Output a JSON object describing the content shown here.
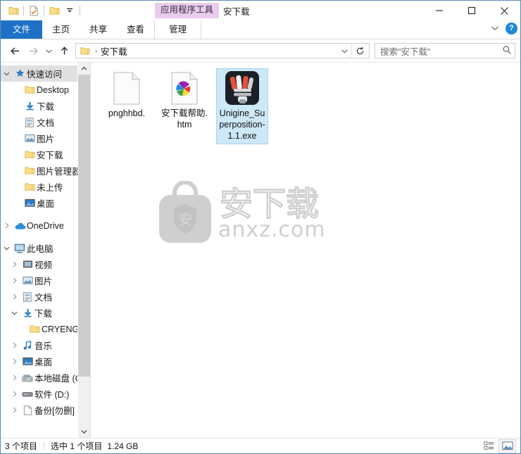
{
  "window": {
    "title": "安下载",
    "contextual_tab_label": "应用程序工具",
    "controls": {
      "minimize": "—",
      "maximize": "▢",
      "close": "✕"
    }
  },
  "quick_access_toolbar": {
    "items": [
      {
        "name": "folder-icon",
        "label": "属性"
      },
      {
        "name": "properties-icon",
        "label": "属性"
      },
      {
        "name": "new-folder-icon",
        "label": "新建文件夹"
      },
      {
        "name": "customize-dropdown-icon",
        "label": "自定义快速访问工具栏"
      }
    ]
  },
  "ribbon": {
    "tabs": [
      {
        "label": "文件",
        "state": "file"
      },
      {
        "label": "主页",
        "state": "normal"
      },
      {
        "label": "共享",
        "state": "normal"
      },
      {
        "label": "查看",
        "state": "normal"
      },
      {
        "label": "管理",
        "state": "contextual-active"
      }
    ],
    "collapse_label": "展开功能区",
    "help_label": "?"
  },
  "nav": {
    "back_label": "后退",
    "forward_label": "前进",
    "recent_label": "最近浏览的位置",
    "up_label": "上移到",
    "address": {
      "crumb": "安下载",
      "separator": "›"
    },
    "address_dropdown_label": "浏览",
    "refresh_label": "刷新",
    "search": {
      "placeholder": "搜索\"安下载\"",
      "value": "",
      "icon": "search-icon"
    }
  },
  "sidebar": {
    "groups": [
      {
        "name": "quick-access",
        "label": "快速访问",
        "icon": "pin-star-icon",
        "expanded": true,
        "selected": true,
        "indent": 0,
        "items": [
          {
            "label": "Desktop",
            "icon": "folder-icon",
            "pinned": true,
            "indent": 1
          },
          {
            "label": "下载",
            "icon": "downloads-icon",
            "pinned": true,
            "indent": 1
          },
          {
            "label": "文档",
            "icon": "documents-icon",
            "pinned": true,
            "indent": 1
          },
          {
            "label": "图片",
            "icon": "pictures-icon",
            "pinned": true,
            "indent": 1
          },
          {
            "label": "安下载",
            "icon": "folder-icon",
            "pinned": false,
            "indent": 1
          },
          {
            "label": "图片管理器",
            "icon": "folder-icon",
            "pinned": false,
            "indent": 1
          },
          {
            "label": "未上传",
            "icon": "folder-icon",
            "pinned": false,
            "indent": 1
          },
          {
            "label": "桌面",
            "icon": "desktop-icon",
            "pinned": false,
            "indent": 1
          }
        ]
      },
      {
        "name": "onedrive",
        "label": "OneDrive",
        "icon": "cloud-icon",
        "expanded": false,
        "selected": false,
        "indent": 0,
        "items": []
      },
      {
        "name": "this-pc",
        "label": "此电脑",
        "icon": "computer-icon",
        "expanded": true,
        "selected": false,
        "indent": 0,
        "items": [
          {
            "label": "视频",
            "icon": "videos-icon",
            "expandable": true,
            "indent": 1
          },
          {
            "label": "图片",
            "icon": "pictures-icon",
            "expandable": true,
            "indent": 1
          },
          {
            "label": "文档",
            "icon": "documents-icon",
            "expandable": true,
            "indent": 1
          },
          {
            "label": "下载",
            "icon": "downloads-icon",
            "expandable": true,
            "expanded": true,
            "indent": 1
          },
          {
            "label": "CRYENGINE",
            "icon": "folder-icon",
            "expandable": false,
            "indent": 2
          },
          {
            "label": "音乐",
            "icon": "music-icon",
            "expandable": true,
            "indent": 1
          },
          {
            "label": "桌面",
            "icon": "desktop-icon",
            "expandable": true,
            "indent": 1
          },
          {
            "label": "本地磁盘 (C:)",
            "icon": "system-drive-icon",
            "expandable": true,
            "indent": 1
          },
          {
            "label": "软件 (D:)",
            "icon": "drive-icon",
            "expandable": true,
            "indent": 1
          },
          {
            "label": "备份[勿删] (E:)",
            "icon": "drive-icon",
            "expandable": true,
            "indent": 1
          }
        ]
      }
    ],
    "scrollbar": {
      "up": "▲",
      "down": "▼"
    }
  },
  "files": {
    "items": [
      {
        "name": "pnghhbd.",
        "icon": "blank-document-icon",
        "selected": false
      },
      {
        "name": "安下载帮助.htm",
        "icon": "html-document-icon",
        "selected": false
      },
      {
        "name": "Unigine_Superposition-1.1.exe",
        "icon": "superposition-app-icon",
        "selected": true
      }
    ],
    "watermark": {
      "brand": "安下载",
      "domain": "anxz.com",
      "shield_char": "安"
    }
  },
  "statusbar": {
    "item_count": "3 个项目",
    "selection": "选中 1 个项目",
    "selection_size": "1.24 GB",
    "views": [
      {
        "name": "details-view-button",
        "label": "详细信息",
        "active": false
      },
      {
        "name": "large-icons-view-button",
        "label": "大图标",
        "active": true
      }
    ]
  },
  "colors": {
    "file_tab_blue": "#1e71c6",
    "contextual_purple": "#e7cdeb",
    "selection_blue": "#cde8f7",
    "window_border": "#5a8ab5",
    "help_blue": "#1e8ad6"
  }
}
